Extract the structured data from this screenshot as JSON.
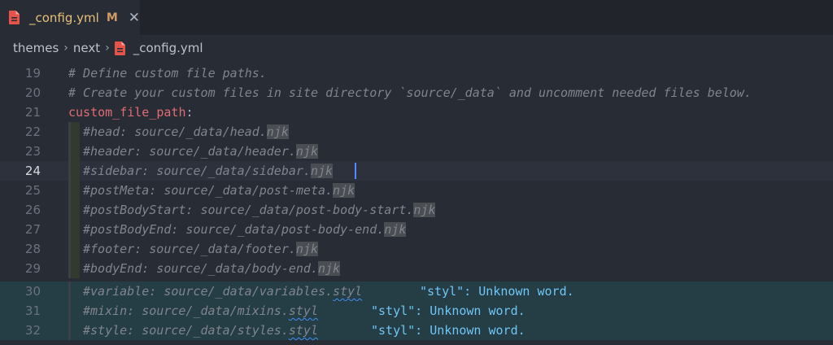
{
  "tab": {
    "filename": "_config.yml",
    "status": "M",
    "close": "✕",
    "icon": "file-icon"
  },
  "breadcrumb": {
    "parts": [
      "themes",
      "next"
    ],
    "separator": "›",
    "file": "_config.yml"
  },
  "lines": [
    {
      "n": "19",
      "text": "# Define custom file paths."
    },
    {
      "n": "20",
      "text": "# Create your custom files in site directory `source/_data` and uncomment needed files below."
    },
    {
      "n": "21",
      "key": "custom_file_path",
      "punct": ":"
    },
    {
      "n": "22",
      "pre": "#head: source/_data/head.",
      "ext": "njk"
    },
    {
      "n": "23",
      "pre": "#header: source/_data/header.",
      "ext": "njk"
    },
    {
      "n": "24",
      "pre": "#sidebar: source/_data/sidebar.",
      "ext": "njk"
    },
    {
      "n": "25",
      "pre": "#postMeta: source/_data/post-meta.",
      "ext": "njk"
    },
    {
      "n": "26",
      "pre": "#postBodyStart: source/_data/post-body-start.",
      "ext": "njk"
    },
    {
      "n": "27",
      "pre": "#postBodyEnd: source/_data/post-body-end.",
      "ext": "njk"
    },
    {
      "n": "28",
      "pre": "#footer: source/_data/footer.",
      "ext": "njk"
    },
    {
      "n": "29",
      "pre": "#bodyEnd: source/_data/body-end.",
      "ext": "njk"
    },
    {
      "n": "30",
      "pre": "#variable: source/_data/variables.",
      "ext": "styl",
      "msg": "\"styl\": Unknown word."
    },
    {
      "n": "31",
      "pre": "#mixin: source/_data/mixins.",
      "ext": "styl",
      "msg": "\"styl\": Unknown word."
    },
    {
      "n": "32",
      "pre": "#style: source/_data/styles.",
      "ext": "styl",
      "msg": "\"styl\": Unknown word."
    }
  ],
  "colors": {
    "error_underline": "#3f8ef6",
    "key": "#e06c75",
    "diagnostic": "#6fc5f5",
    "modified": "#d19a66"
  }
}
